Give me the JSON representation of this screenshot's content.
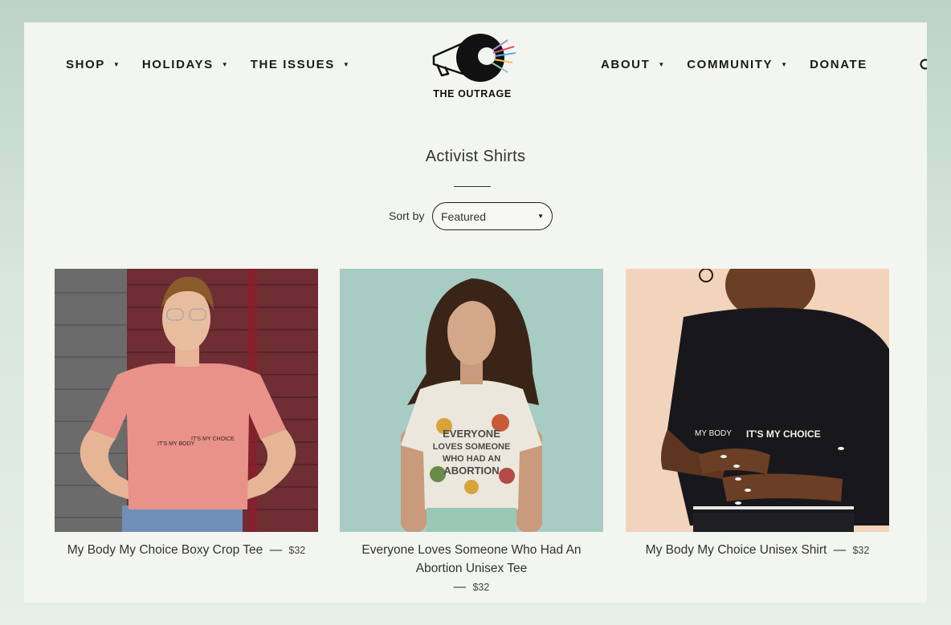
{
  "nav": {
    "left": [
      {
        "label": "SHOP"
      },
      {
        "label": "HOLIDAYS"
      },
      {
        "label": "THE ISSUES"
      }
    ],
    "right": [
      {
        "label": "ABOUT"
      },
      {
        "label": "COMMUNITY"
      },
      {
        "label": "DONATE"
      }
    ]
  },
  "logo": {
    "text": "THE OUTRAGE"
  },
  "collection": {
    "title": "Activist Shirts",
    "sort_label": "Sort by",
    "sort_value": "Featured"
  },
  "products": [
    {
      "name": "My Body My Choice Boxy Crop Tee",
      "dash": "—",
      "price": "$32",
      "shirt_text_left": "IT'S MY BODY",
      "shirt_text_right": "IT'S MY CHOICE"
    },
    {
      "name": "Everyone Loves Someone Who Had An Abortion Unisex Tee",
      "dash": "—",
      "price": "$32",
      "shirt_lines": [
        "EVERYONE",
        "LOVES SOMEONE",
        "WHO HAD AN",
        "ABORTION"
      ]
    },
    {
      "name": "My Body My Choice Unisex Shirt",
      "dash": "—",
      "price": "$32",
      "shirt_text_left": "MY BODY",
      "shirt_text_right": "IT'S MY CHOICE"
    }
  ],
  "colors": {
    "page_bg": "#f3f5f0",
    "outer_bg": "#bcd3c6",
    "text": "#1a1a1a"
  }
}
